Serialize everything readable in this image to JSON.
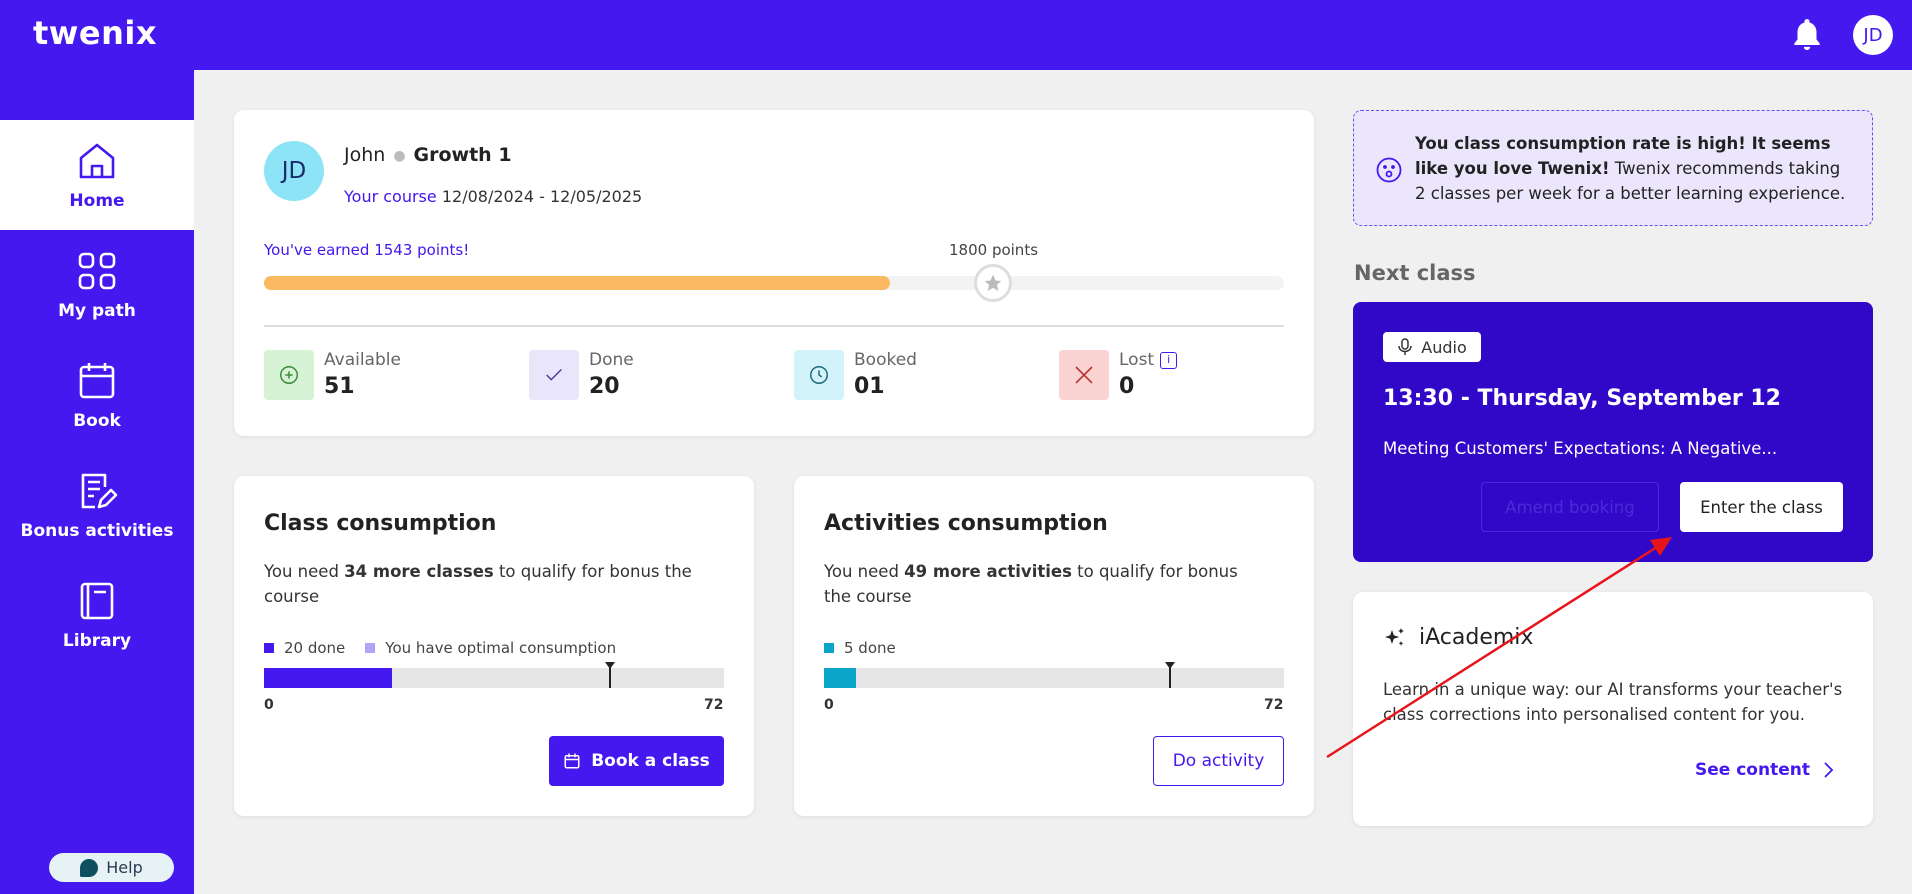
{
  "app": {
    "logo": "twenix"
  },
  "header": {
    "avatar_initials": "JD"
  },
  "sidebar": {
    "items": [
      {
        "label": "Home",
        "icon": "home-icon"
      },
      {
        "label": "My path",
        "icon": "grid-icon"
      },
      {
        "label": "Book",
        "icon": "calendar-icon"
      },
      {
        "label": "Bonus activities",
        "icon": "notes-edit-icon"
      },
      {
        "label": "Library",
        "icon": "book-icon"
      }
    ],
    "help_label": "Help"
  },
  "profile": {
    "initials": "JD",
    "name": "John",
    "course": "Growth 1",
    "course_label": "Your course",
    "course_dates": "12/08/2024 - 12/05/2025",
    "earned_text": "You've earned 1543 points!",
    "goal_text": "1800 points",
    "points_progress": 0.614
  },
  "stats": [
    {
      "label": "Available",
      "value": "51",
      "icon": "plus-circle-icon",
      "color": "#d6f3d6"
    },
    {
      "label": "Done",
      "value": "20",
      "icon": "check-icon",
      "color": "#e9e6fb"
    },
    {
      "label": "Booked",
      "value": "01",
      "icon": "clock-icon",
      "color": "#d2f3f9"
    },
    {
      "label": "Lost",
      "value": "0",
      "icon": "x-icon",
      "color": "#fbd3d3"
    }
  ],
  "lost_info": "i",
  "class_consumption": {
    "title": "Class consumption",
    "desc_pre": "You need ",
    "desc_bold": "34 more classes",
    "desc_post": " to qualify for bonus the course",
    "legend_done": "20 done",
    "legend_optimal": "You have optimal consumption",
    "min": "0",
    "max": "72",
    "done_fraction": 0.278,
    "marker_fraction": 0.75,
    "button": "Book a class",
    "color": "#4418ee"
  },
  "activities_consumption": {
    "title": "Activities consumption",
    "desc_pre": "You need ",
    "desc_bold": "49 more activities",
    "desc_post": " to qualify for bonus the course",
    "legend_done": "5 done",
    "min": "0",
    "max": "72",
    "done_fraction": 0.069,
    "marker_fraction": 0.75,
    "button": "Do activity",
    "color": "#0aa5c9"
  },
  "alert": {
    "bold": "You class consumption rate is high! It seems like you love Twenix!",
    "rest": " Twenix recommends taking 2 classes per week for a better learning experience."
  },
  "next_class": {
    "heading": "Next class",
    "chip": "Audio",
    "time": "13:30 - Thursday, September 12",
    "topic": "Meeting Customers' Expectations: A Negative...",
    "amend": "Amend booking",
    "enter": "Enter the class"
  },
  "iacademix": {
    "title": "iAcademix",
    "desc": "Learn in a unique way: our AI transforms your teacher's class corrections into personalised content for you.",
    "link": "See content"
  }
}
